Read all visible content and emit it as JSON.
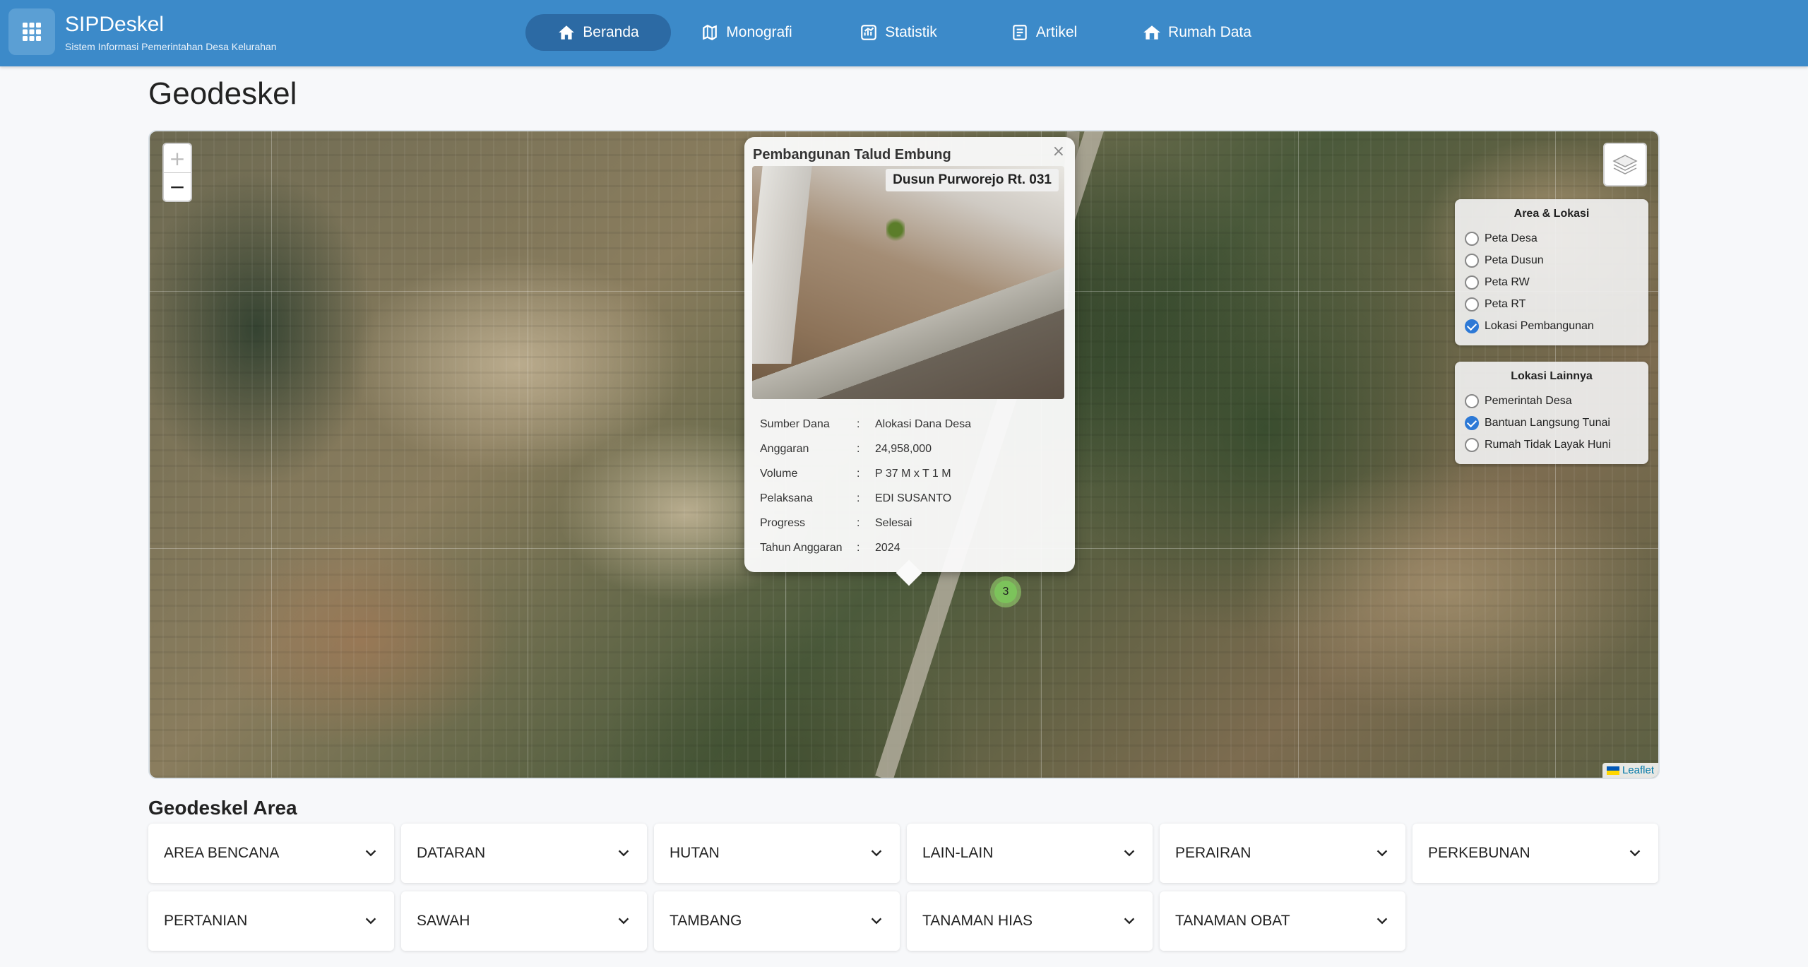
{
  "header": {
    "app_title": "SIPDeskel",
    "app_subtitle": "Sistem Informasi Pemerintahan Desa Kelurahan",
    "nav": [
      {
        "label": "Beranda",
        "icon": "home-icon",
        "active": true
      },
      {
        "label": "Monografi",
        "icon": "map-icon",
        "active": false
      },
      {
        "label": "Statistik",
        "icon": "chart-icon",
        "active": false
      },
      {
        "label": "Artikel",
        "icon": "article-icon",
        "active": false
      },
      {
        "label": "Rumah Data",
        "icon": "house-data-icon",
        "active": false
      }
    ]
  },
  "page_title": "Geodeskel",
  "map": {
    "zoom_in": "+",
    "zoom_out": "−",
    "cluster_count": "3",
    "attribution": "Leaflet",
    "popup": {
      "title": "Pembangunan Talud Embung",
      "photo_label": "Dusun Purworejo Rt. 031",
      "close": "×",
      "rows": [
        {
          "key": "Sumber Dana",
          "value": "Alokasi Dana Desa"
        },
        {
          "key": "Anggaran",
          "value": "24,958,000"
        },
        {
          "key": "Volume",
          "value": "P 37 M x T 1 M"
        },
        {
          "key": "Pelaksana",
          "value": "EDI SUSANTO"
        },
        {
          "key": "Progress",
          "value": "Selesai"
        },
        {
          "key": "Tahun Anggaran",
          "value": "2024"
        }
      ]
    },
    "panels": [
      {
        "title": "Area & Lokasi",
        "options": [
          {
            "label": "Peta Desa",
            "checked": false
          },
          {
            "label": "Peta Dusun",
            "checked": false
          },
          {
            "label": "Peta RW",
            "checked": false
          },
          {
            "label": "Peta RT",
            "checked": false
          },
          {
            "label": "Lokasi Pembangunan",
            "checked": true
          }
        ]
      },
      {
        "title": "Lokasi Lainnya",
        "options": [
          {
            "label": "Pemerintah Desa",
            "checked": false
          },
          {
            "label": "Bantuan Langsung Tunai",
            "checked": true
          },
          {
            "label": "Rumah Tidak Layak Huni",
            "checked": false
          }
        ]
      }
    ]
  },
  "area": {
    "title": "Geodeskel Area",
    "items": [
      "AREA BENCANA",
      "DATARAN",
      "HUTAN",
      "LAIN-LAIN",
      "PERAIRAN",
      "PERKEBUNAN",
      "PERTANIAN",
      "SAWAH",
      "TAMBANG",
      "TANAMAN HIAS",
      "TANAMAN OBAT"
    ]
  },
  "colors": {
    "header": "#3c8ac9",
    "nav_active": "#2c6aa4",
    "checked": "#2d79d6",
    "cluster": "#7cc35b"
  }
}
